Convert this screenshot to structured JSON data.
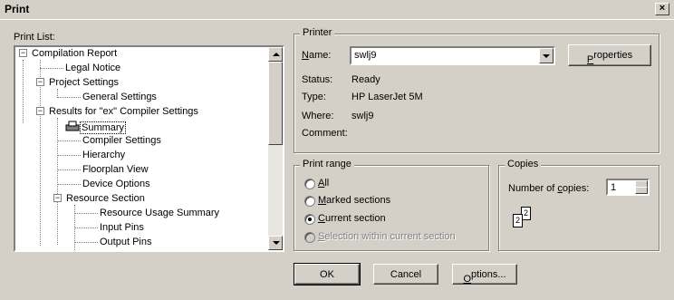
{
  "window": {
    "title": "Print",
    "close_label": "×"
  },
  "print_list": {
    "label": "Print List:",
    "items": [
      {
        "label": "Compilation Report"
      },
      {
        "label": "Legal Notice"
      },
      {
        "label": "Project Settings"
      },
      {
        "label": "General Settings"
      },
      {
        "label": "Results for \"ex\" Compiler Settings"
      },
      {
        "label": "Summary",
        "selected": true
      },
      {
        "label": "Compiler Settings"
      },
      {
        "label": "Hierarchy"
      },
      {
        "label": "Floorplan View"
      },
      {
        "label": "Device Options"
      },
      {
        "label": "Resource Section"
      },
      {
        "label": "Resource Usage Summary"
      },
      {
        "label": "Input Pins"
      },
      {
        "label": "Output Pins"
      }
    ]
  },
  "printer": {
    "group_title": "Printer",
    "name_label": "Name:",
    "name_value": "swlj9",
    "properties_button": "Properties",
    "status_label": "Status:",
    "status_value": "Ready",
    "type_label": "Type:",
    "type_value": "HP LaserJet 5M",
    "where_label": "Where:",
    "where_value": "swlj9",
    "comment_label": "Comment:",
    "comment_value": ""
  },
  "print_range": {
    "group_title": "Print range",
    "options": [
      {
        "label": "All",
        "checked": false,
        "disabled": false
      },
      {
        "label": "Marked sections",
        "checked": false,
        "disabled": false
      },
      {
        "label": "Current section",
        "checked": true,
        "disabled": false
      },
      {
        "label": "Selection within current section",
        "checked": false,
        "disabled": true
      }
    ]
  },
  "copies": {
    "group_title": "Copies",
    "number_label": "Number of copies:",
    "number_value": "1",
    "collate_page_1": "2",
    "collate_page_2": "2"
  },
  "buttons": {
    "ok": "OK",
    "cancel": "Cancel",
    "options": "Options..."
  }
}
